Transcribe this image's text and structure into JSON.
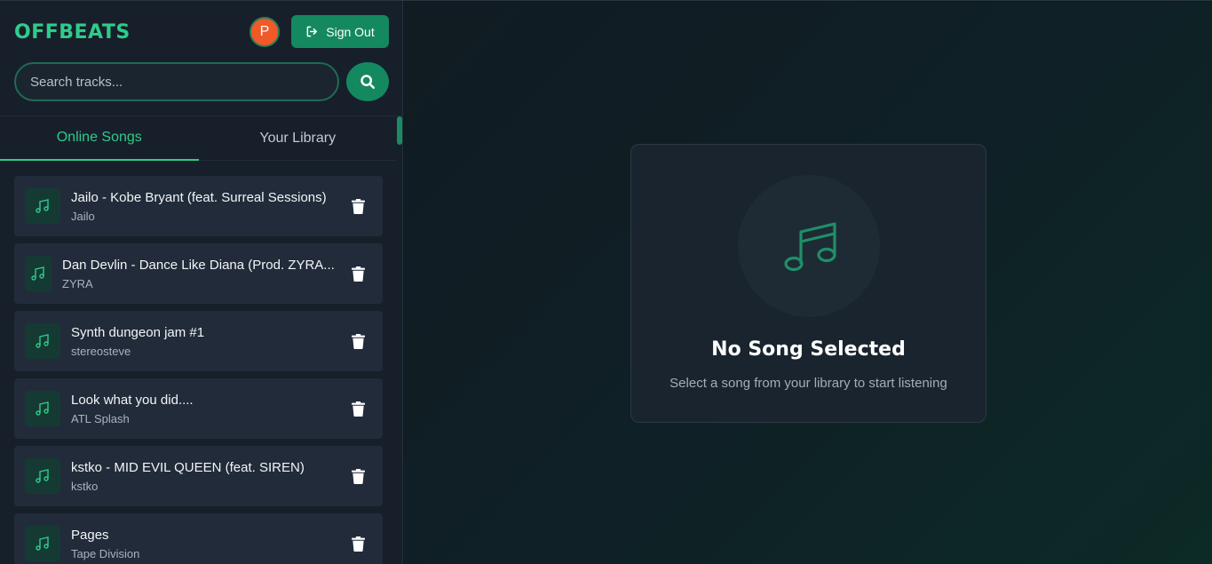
{
  "header": {
    "brand": "OFFBEATS",
    "avatar_initial": "P",
    "signout_label": "Sign Out"
  },
  "search": {
    "placeholder": "Search tracks...",
    "value": ""
  },
  "tabs": [
    {
      "label": "Online Songs",
      "active": true
    },
    {
      "label": "Your Library",
      "active": false
    }
  ],
  "songs": [
    {
      "title": "Jailo - Kobe Bryant (feat. Surreal Sessions)",
      "artist": "Jailo"
    },
    {
      "title": "Dan Devlin - Dance Like Diana (Prod. ZYRA...",
      "artist": "ZYRA"
    },
    {
      "title": "Synth dungeon jam #1",
      "artist": "stereosteve"
    },
    {
      "title": "Look what you did....",
      "artist": "ATL Splash"
    },
    {
      "title": "kstko - MID EVIL QUEEN (feat. SIREN)",
      "artist": "kstko"
    },
    {
      "title": "Pages",
      "artist": "Tape Division"
    }
  ],
  "empty_state": {
    "title": "No Song Selected",
    "subtitle": "Select a song from your library to start listening",
    "icon": "music-note-icon"
  },
  "colors": {
    "accent": "#2ecc8a",
    "button": "#14895f",
    "avatar": "#f05a28",
    "sidebar_bg": "#171f2a",
    "card_bg": "#222b39"
  }
}
